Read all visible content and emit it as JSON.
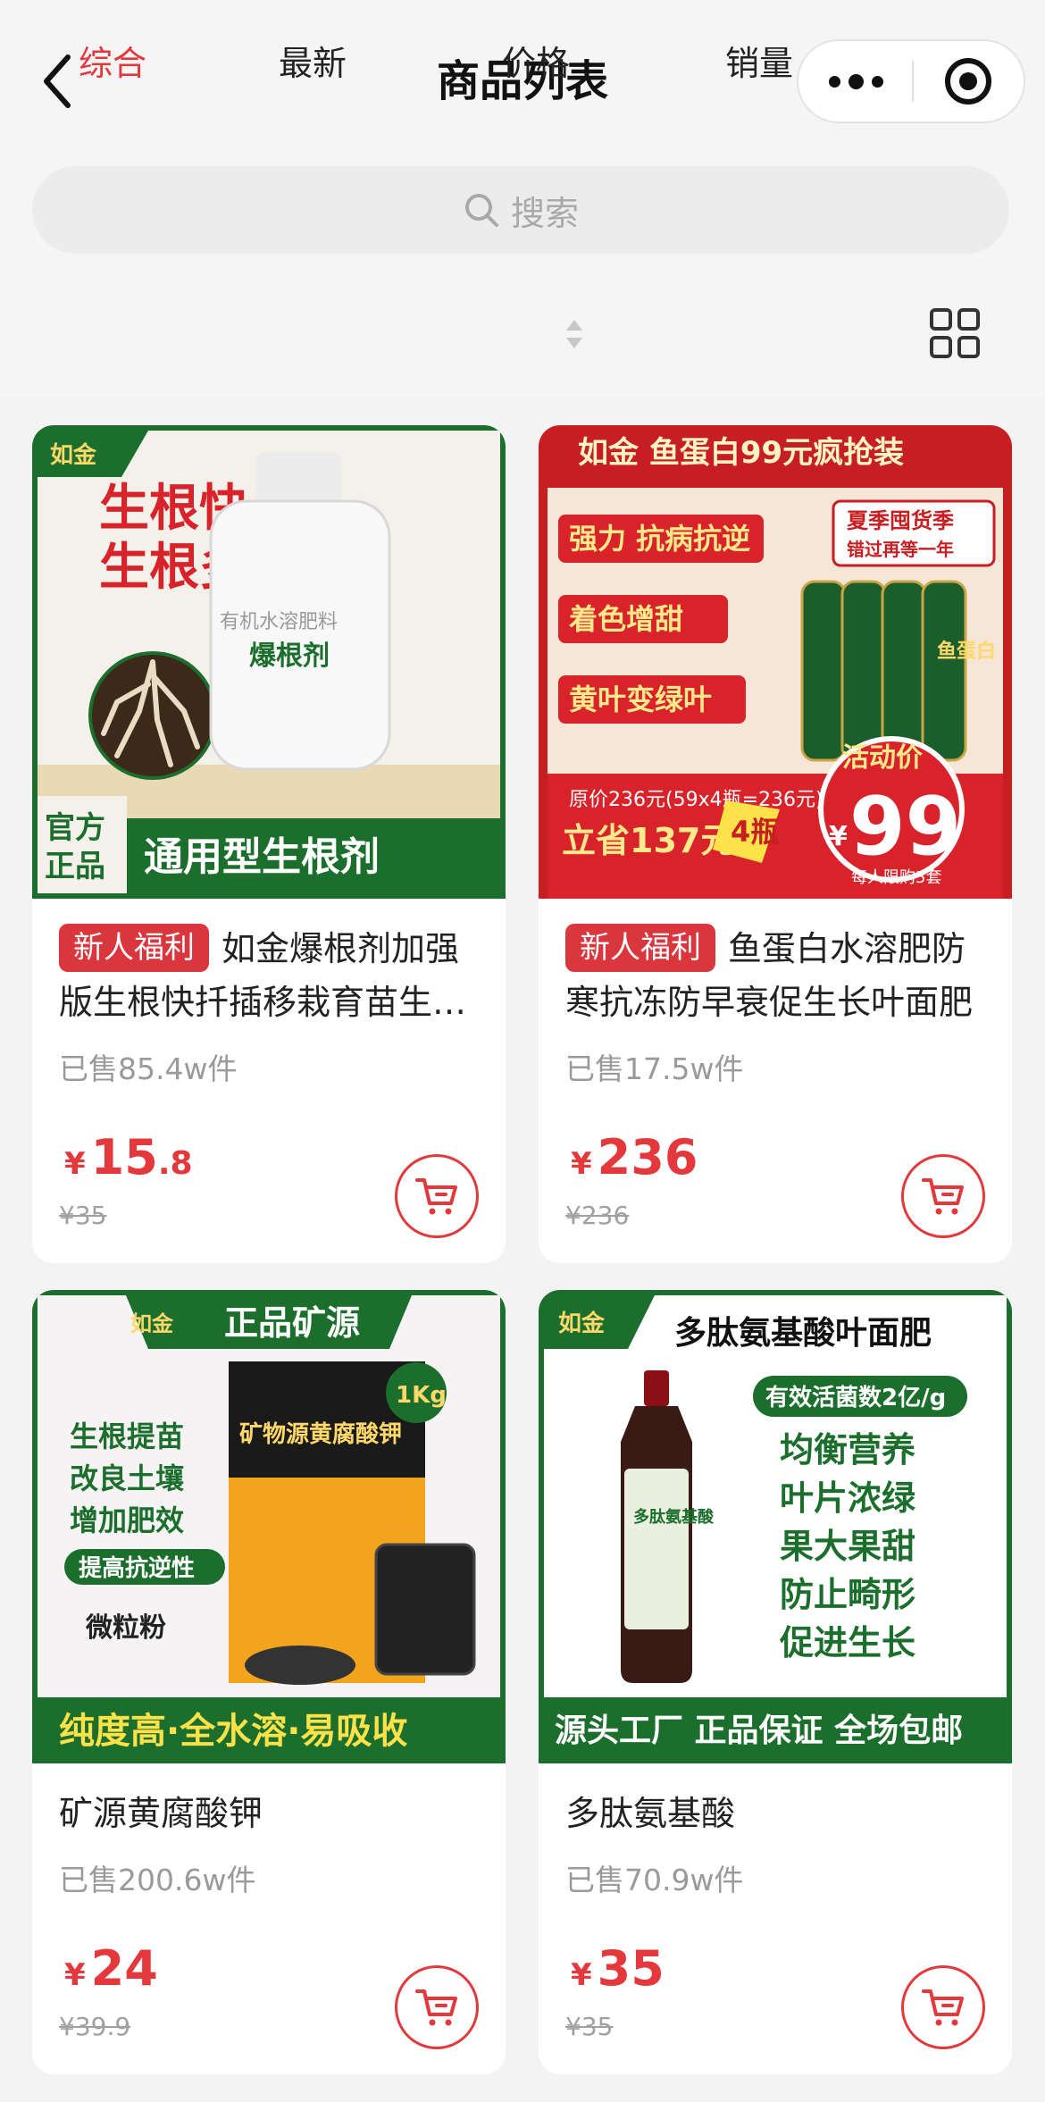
{
  "header": {
    "title": "商品列表",
    "back_icon": "chevron-left-icon",
    "more_icon": "more-dots-icon",
    "close_icon": "target-close-icon"
  },
  "search": {
    "placeholder": "搜索",
    "icon": "search-icon"
  },
  "sort_tabs": [
    {
      "label": "综合",
      "active": true
    },
    {
      "label": "最新",
      "active": false
    },
    {
      "label": "价格",
      "active": false
    },
    {
      "label": "销量",
      "active": false
    }
  ],
  "layout_toggle_icon": "grid-view-icon",
  "colors": {
    "accent": "#e4393c",
    "badge": "#d9363e",
    "background": "#f5f5f5",
    "card": "#ffffff",
    "brand_green": "#1b6e2c"
  },
  "products": [
    {
      "badge": "新人福利",
      "title": "如金爆根剂加强版生根快扦插移栽育苗生根壮苗",
      "sold": "已售85.4w件",
      "price_yen": "¥",
      "price_int": "15",
      "price_dec": ".8",
      "original_price": "¥35",
      "image": {
        "brand": "如金",
        "headline_1": "生根快",
        "headline_2": "生根多",
        "bottle_label_1": "有机水溶肥料",
        "bottle_label_2": "爆根剂",
        "corner_1": "官方",
        "corner_2": "正品",
        "banner": "通用型生根剂"
      }
    },
    {
      "badge": "新人福利",
      "title": "鱼蛋白水溶肥防寒抗冻防早衰促生长叶面肥",
      "sold": "已售17.5w件",
      "price_yen": "¥",
      "price_int": "236",
      "price_dec": "",
      "original_price": "¥236",
      "image": {
        "top_banner": "如金  鱼蛋白99元疯抢装",
        "tag_1": "强力 抗病抗逆",
        "tag_2": "着色增甜",
        "tag_3": "黄叶变绿叶",
        "season_1": "夏季囤货季",
        "season_2": "错过再等一年",
        "orig_note": "原价236元(59x4瓶=236元)",
        "save_note": "立省137元",
        "four_bottles": "4瓶",
        "promo_label": "活动价",
        "promo_yen": "¥",
        "promo_price": "99",
        "limit": "每人限购5套",
        "bottle_text": "鱼蛋白"
      }
    },
    {
      "badge": "",
      "title": "矿源黄腐酸钾",
      "sold": "已售200.6w件",
      "price_yen": "¥",
      "price_int": "24",
      "price_dec": "",
      "original_price": "¥39.9",
      "image": {
        "brand": "如金",
        "top_banner": "正品矿源",
        "line_1": "生根提苗",
        "line_2": "改良土壤",
        "line_3": "增加肥效",
        "pill": "提高抗逆性",
        "form": "微粒粉",
        "bag_title": "矿物源黄腐酸钾",
        "weight": "1Kg",
        "banner": "纯度高·全水溶·易吸收"
      }
    },
    {
      "badge": "",
      "title": "多肽氨基酸",
      "sold": "已售70.9w件",
      "price_yen": "¥",
      "price_int": "35",
      "price_dec": "",
      "original_price": "¥35",
      "image": {
        "brand": "如金",
        "top_title": "多肽氨基酸叶面肥",
        "pill": "有效活菌数2亿/g",
        "line_1": "均衡营养",
        "line_2": "叶片浓绿",
        "line_3": "果大果甜",
        "line_4": "防止畸形",
        "line_5": "促进生长",
        "bottle_text": "多肽氨基酸",
        "banner": "源头工厂 正品保证 全场包邮"
      }
    }
  ]
}
